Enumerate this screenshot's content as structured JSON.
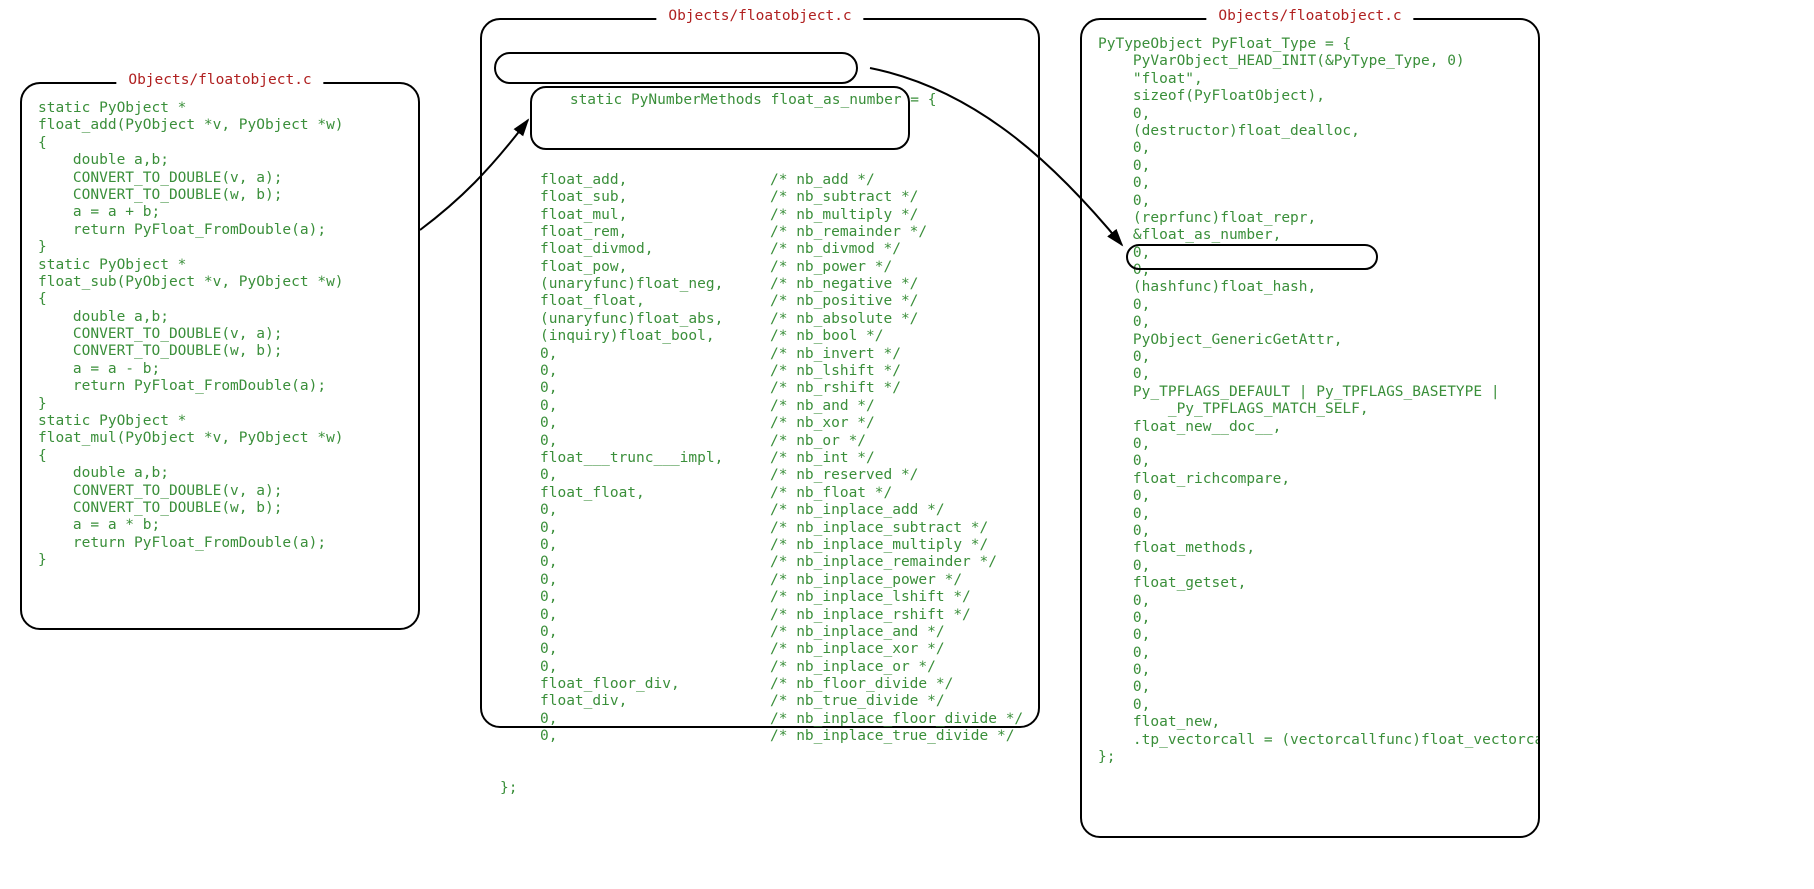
{
  "panels": {
    "left": {
      "title": "Objects/floatobject.c",
      "code": [
        "static PyObject *",
        "float_add(PyObject *v, PyObject *w)",
        "{",
        "    double a,b;",
        "    CONVERT_TO_DOUBLE(v, a);",
        "    CONVERT_TO_DOUBLE(w, b);",
        "    a = a + b;",
        "    return PyFloat_FromDouble(a);",
        "}",
        "",
        "static PyObject *",
        "float_sub(PyObject *v, PyObject *w)",
        "{",
        "    double a,b;",
        "    CONVERT_TO_DOUBLE(v, a);",
        "    CONVERT_TO_DOUBLE(w, b);",
        "    a = a - b;",
        "    return PyFloat_FromDouble(a);",
        "}",
        "",
        "static PyObject *",
        "float_mul(PyObject *v, PyObject *w)",
        "{",
        "    double a,b;",
        "    CONVERT_TO_DOUBLE(v, a);",
        "    CONVERT_TO_DOUBLE(w, b);",
        "    a = a * b;",
        "    return PyFloat_FromDouble(a);",
        "}"
      ]
    },
    "middle": {
      "title": "Objects/floatobject.c",
      "decl": "static PyNumberMethods float_as_number",
      "decl_suffix": " = {",
      "rows": [
        {
          "f": "float_add,",
          "c": "/* nb_add */"
        },
        {
          "f": "float_sub,",
          "c": "/* nb_subtract */"
        },
        {
          "f": "float_mul,",
          "c": "/* nb_multiply */"
        },
        {
          "f": "float_rem,",
          "c": "/* nb_remainder */"
        },
        {
          "f": "float_divmod,",
          "c": "/* nb_divmod */"
        },
        {
          "f": "float_pow,",
          "c": "/* nb_power */"
        },
        {
          "f": "(unaryfunc)float_neg,",
          "c": "/* nb_negative */"
        },
        {
          "f": "float_float,",
          "c": "/* nb_positive */"
        },
        {
          "f": "(unaryfunc)float_abs,",
          "c": "/* nb_absolute */"
        },
        {
          "f": "(inquiry)float_bool,",
          "c": "/* nb_bool */"
        },
        {
          "f": "0,",
          "c": "/* nb_invert */"
        },
        {
          "f": "0,",
          "c": "/* nb_lshift */"
        },
        {
          "f": "0,",
          "c": "/* nb_rshift */"
        },
        {
          "f": "0,",
          "c": "/* nb_and */"
        },
        {
          "f": "0,",
          "c": "/* nb_xor */"
        },
        {
          "f": "0,",
          "c": "/* nb_or */"
        },
        {
          "f": "float___trunc___impl,",
          "c": "/* nb_int */"
        },
        {
          "f": "0,",
          "c": "/* nb_reserved */"
        },
        {
          "f": "float_float,",
          "c": "/* nb_float */"
        },
        {
          "f": "0,",
          "c": "/* nb_inplace_add */"
        },
        {
          "f": "0,",
          "c": "/* nb_inplace_subtract */"
        },
        {
          "f": "0,",
          "c": "/* nb_inplace_multiply */"
        },
        {
          "f": "0,",
          "c": "/* nb_inplace_remainder */"
        },
        {
          "f": "0,",
          "c": "/* nb_inplace_power */"
        },
        {
          "f": "0,",
          "c": "/* nb_inplace_lshift */"
        },
        {
          "f": "0,",
          "c": "/* nb_inplace_rshift */"
        },
        {
          "f": "0,",
          "c": "/* nb_inplace_and */"
        },
        {
          "f": "0,",
          "c": "/* nb_inplace_xor */"
        },
        {
          "f": "0,",
          "c": "/* nb_inplace_or */"
        },
        {
          "f": "float_floor_div,",
          "c": "/* nb_floor_divide */"
        },
        {
          "f": "float_div,",
          "c": "/* nb_true_divide */"
        },
        {
          "f": "0,",
          "c": "/* nb_inplace_floor_divide */"
        },
        {
          "f": "0,",
          "c": "/* nb_inplace_true_divide */"
        }
      ],
      "close": "};"
    },
    "right": {
      "title": "Objects/floatobject.c",
      "code": [
        "PyTypeObject PyFloat_Type = {",
        "    PyVarObject_HEAD_INIT(&PyType_Type, 0)",
        "    \"float\",",
        "    sizeof(PyFloatObject),",
        "    0,",
        "    (destructor)float_dealloc,",
        "    0,",
        "    0,",
        "    0,",
        "    0,",
        "    (reprfunc)float_repr,",
        "    &float_as_number,",
        "    0,",
        "    0,",
        "    (hashfunc)float_hash,",
        "    0,",
        "    0,",
        "    PyObject_GenericGetAttr,",
        "    0,",
        "    0,",
        "    Py_TPFLAGS_DEFAULT | Py_TPFLAGS_BASETYPE |",
        "        _Py_TPFLAGS_MATCH_SELF,",
        "    float_new__doc__,",
        "    0,",
        "    0,",
        "    float_richcompare,",
        "    0,",
        "    0,",
        "    0,",
        "    float_methods,",
        "    0,",
        "    float_getset,",
        "    0,",
        "    0,",
        "    0,",
        "    0,",
        "    0,",
        "    0,",
        "    0,",
        "    float_new,",
        "    .tp_vectorcall = (vectorcallfunc)float_vectorcall,",
        "};"
      ]
    }
  }
}
